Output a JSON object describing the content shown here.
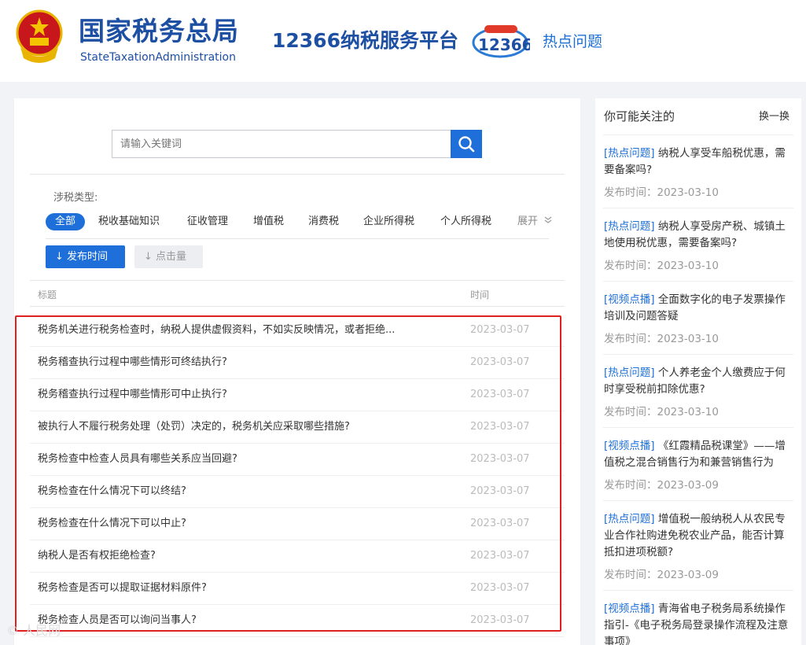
{
  "header": {
    "brand_cn": "国家税务总局",
    "brand_en": "StateTaxationAdministration",
    "platform": "12366纳税服务平台",
    "logo_text": "12366",
    "hot_link": "热点问题"
  },
  "search": {
    "placeholder": "请输入关键词"
  },
  "filters": {
    "type_label": "涉税类型:",
    "categories": [
      "全部",
      "税收基础知识",
      "征收管理",
      "增值税",
      "消费税",
      "企业所得税",
      "个人所得税"
    ],
    "expand": "展开"
  },
  "sort": {
    "publish_time": "发布时间",
    "clicks": "点击量"
  },
  "table": {
    "headers": {
      "title": "标题",
      "time": "时间"
    },
    "rows": [
      {
        "title": "税务机关进行税务检查时，纳税人提供虚假资料，不如实反映情况，或者拒绝...",
        "date": "2023-03-07"
      },
      {
        "title": "税务稽查执行过程中哪些情形可终结执行?",
        "date": "2023-03-07"
      },
      {
        "title": "税务稽查执行过程中哪些情形可中止执行?",
        "date": "2023-03-07"
      },
      {
        "title": "被执行人不履行税务处理（处罚）决定的，税务机关应采取哪些措施?",
        "date": "2023-03-07"
      },
      {
        "title": "税务检查中检查人员具有哪些关系应当回避?",
        "date": "2023-03-07"
      },
      {
        "title": "税务检查在什么情况下可以终结?",
        "date": "2023-03-07"
      },
      {
        "title": "税务检查在什么情况下可以中止?",
        "date": "2023-03-07"
      },
      {
        "title": "纳税人是否有权拒绝检查?",
        "date": "2023-03-07"
      },
      {
        "title": "税务检查是否可以提取证据材料原件?",
        "date": "2023-03-07"
      },
      {
        "title": "税务检查人员是否可以询问当事人?",
        "date": "2023-03-07"
      }
    ]
  },
  "sidebar": {
    "title": "你可能关注的",
    "refresh": "换一换",
    "date_prefix": "发布时间：",
    "items": [
      {
        "tag": "[热点问题]",
        "text": "纳税人享受车船税优惠，需要备案吗?",
        "date": "2023-03-10"
      },
      {
        "tag": "[热点问题]",
        "text": "纳税人享受房产税、城镇土地使用税优惠，需要备案吗?",
        "date": "2023-03-10"
      },
      {
        "tag": "[视频点播]",
        "text": "全面数字化的电子发票操作培训及问题答疑",
        "date": "2023-03-10"
      },
      {
        "tag": "[热点问题]",
        "text": "个人养老金个人缴费应于何时享受税前扣除优惠?",
        "date": "2023-03-10"
      },
      {
        "tag": "[视频点播]",
        "text": "《红霞精品税课堂》——增值税之混合销售行为和兼营销售行为",
        "date": "2023-03-09"
      },
      {
        "tag": "[热点问题]",
        "text": "增值税一般纳税人从农民专业合作社购进免税农业产品，能否计算抵扣进项税额?",
        "date": "2023-03-09"
      },
      {
        "tag": "[视频点播]",
        "text": "青海省电子税务局系统操作指引-《电子税务局登录操作流程及注意事项》",
        "date": ""
      }
    ]
  },
  "watermark": "© 人民网",
  "colors": {
    "brand_blue": "#1d4fa3",
    "accent": "#1e6fd9",
    "highlight": "#e02020"
  }
}
